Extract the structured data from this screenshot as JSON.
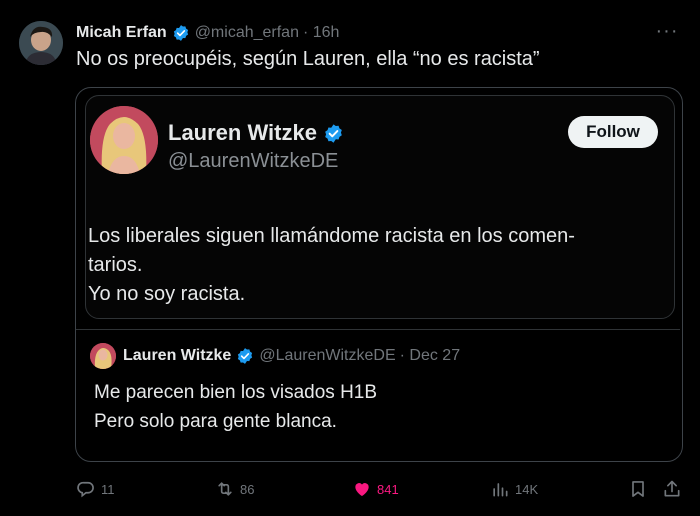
{
  "author": {
    "name": "Micah Erfan",
    "handle": "@micah_erfan",
    "time": "· 16h"
  },
  "post_text": "No os preocupéis, según Lauren, ella “no es racista”",
  "quoted_screenshot": {
    "name": "Lauren Witzke",
    "handle": "@LaurenWitzkeDE",
    "follow_label": "Follow",
    "text_lines": [
      "Los liberales siguen llamándome racista en los comen-",
      "tarios.",
      "Yo no soy racista."
    ]
  },
  "nested_quote": {
    "name": "Lauren Witzke",
    "handle": "@LaurenWitzkeDE",
    "date": "· Dec 27",
    "text_lines": [
      "Me parecen bien los visados H1B",
      "Pero solo para gente blanca."
    ]
  },
  "actions": {
    "replies": "11",
    "reposts": "86",
    "likes": "841",
    "views": "14K"
  },
  "colors": {
    "background": "#000000",
    "verified": "#1d9bf0",
    "like": "#f91880",
    "muted": "#71767b"
  },
  "icons": [
    "verified-badge-icon",
    "more-icon",
    "reply-icon",
    "repost-icon",
    "heart-icon",
    "views-icon",
    "bookmark-icon",
    "share-icon"
  ]
}
